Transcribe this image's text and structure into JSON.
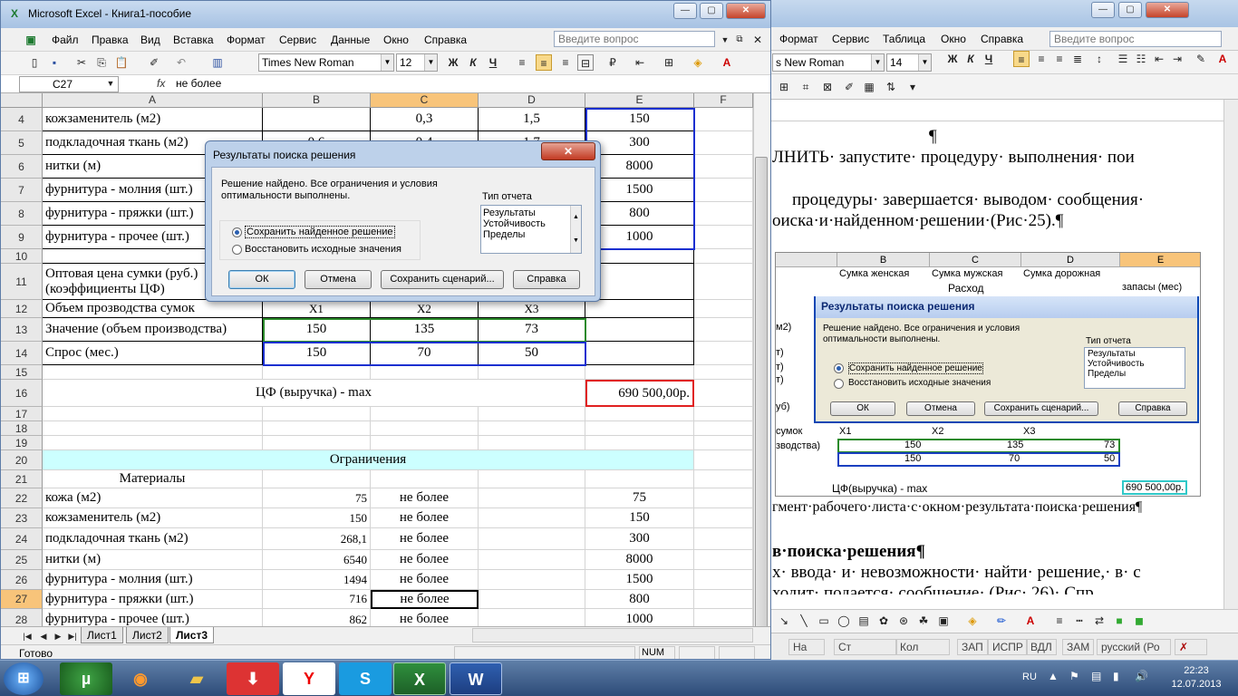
{
  "excel": {
    "title": "Microsoft Excel - Книга1-пособие",
    "menu": [
      "Файл",
      "Правка",
      "Вид",
      "Вставка",
      "Формат",
      "Сервис",
      "Данные",
      "Окно",
      "Справка"
    ],
    "ask_placeholder": "Введите вопрос",
    "font": "Times New Roman",
    "font_size": "12",
    "name_box": "C27",
    "fx": "fx",
    "formula": "не более",
    "columns": [
      "A",
      "B",
      "C",
      "D",
      "E",
      "F"
    ],
    "rows": [
      {
        "n": "4",
        "a": "кожзаменитель (м2)",
        "b": "",
        "c": "0,3",
        "d": "1,5",
        "e": "150"
      },
      {
        "n": "5",
        "a": "подкладочная ткань (м2)",
        "b": "0,6",
        "c": "0,4",
        "d": "1,7",
        "e": "300"
      },
      {
        "n": "6",
        "a": "нитки (м)",
        "b": "",
        "c": "",
        "d": "",
        "e": "8000"
      },
      {
        "n": "7",
        "a": "фурнитура - молния (шт.)",
        "b": "",
        "c": "",
        "d": "",
        "e": "1500"
      },
      {
        "n": "8",
        "a": "фурнитура - пряжки (шт.)",
        "b": "",
        "c": "",
        "d": "",
        "e": "800"
      },
      {
        "n": "9",
        "a": "фурнитура - прочее (шт.)",
        "b": "",
        "c": "",
        "d": "",
        "e": "1000"
      },
      {
        "n": "10",
        "a": "",
        "b": "",
        "c": "",
        "d": "",
        "e": ""
      },
      {
        "n": "11",
        "a": "Оптовая цена сумки (руб.)",
        "a2": "(коэффициенты ЦФ)",
        "b": "",
        "c": "",
        "d": "",
        "e": ""
      },
      {
        "n": "12",
        "a": "Объем прозводства сумок",
        "b": "X1",
        "c": "X2",
        "d": "X3",
        "e": ""
      },
      {
        "n": "13",
        "a": "Значение (объем производства)",
        "b": "150",
        "c": "135",
        "d": "73",
        "e": ""
      },
      {
        "n": "14",
        "a": "Спрос (мес.)",
        "b": "150",
        "c": "70",
        "d": "50",
        "e": ""
      },
      {
        "n": "15",
        "a": "",
        "b": "",
        "c": "",
        "d": "",
        "e": ""
      },
      {
        "n": "16",
        "a": "ЦФ (выручка) - max",
        "b": "",
        "c": "",
        "d": "",
        "e": "690 500,00р."
      },
      {
        "n": "17",
        "a": "",
        "b": "",
        "c": "",
        "d": "",
        "e": ""
      },
      {
        "n": "18",
        "a": "",
        "b": "",
        "c": "",
        "d": "",
        "e": ""
      },
      {
        "n": "19",
        "a": "",
        "b": "",
        "c": "",
        "d": "",
        "e": ""
      },
      {
        "n": "20",
        "a": "Ограничения",
        "b": "",
        "c": "",
        "d": "",
        "e": ""
      },
      {
        "n": "21",
        "a": "Материалы",
        "b": "",
        "c": "",
        "d": "",
        "e": ""
      },
      {
        "n": "22",
        "a": "кожа (м2)",
        "b": "75",
        "c": "не более",
        "d": "",
        "e": "75"
      },
      {
        "n": "23",
        "a": "кожзаменитель (м2)",
        "b": "150",
        "c": "не более",
        "d": "",
        "e": "150"
      },
      {
        "n": "24",
        "a": "подкладочная ткань (м2)",
        "b": "268,1",
        "c": "не более",
        "d": "",
        "e": "300"
      },
      {
        "n": "25",
        "a": "нитки (м)",
        "b": "6540",
        "c": "не более",
        "d": "",
        "e": "8000"
      },
      {
        "n": "26",
        "a": "фурнитура - молния (шт.)",
        "b": "1494",
        "c": "не более",
        "d": "",
        "e": "1500"
      },
      {
        "n": "27",
        "a": "фурнитура - пряжки (шт.)",
        "b": "716",
        "c": "не более",
        "d": "",
        "e": "800"
      },
      {
        "n": "28",
        "a": "фурнитура - прочее (шт.)",
        "b": "862",
        "c": "не более",
        "d": "",
        "e": "1000"
      }
    ],
    "sheets": [
      "Лист1",
      "Лист2",
      "Лист3"
    ],
    "status": "Готово",
    "num": "NUM"
  },
  "dialog": {
    "title": "Результаты поиска решения",
    "message_line1": "Решение найдено. Все ограничения и условия",
    "message_line2": "оптимальности выполнены.",
    "report_label": "Тип отчета",
    "reports": [
      "Результаты",
      "Устойчивость",
      "Пределы"
    ],
    "option_keep": "Сохранить найденное решение",
    "option_restore": "Восстановить исходные значения",
    "btn_ok": "ОК",
    "btn_cancel": "Отмена",
    "btn_save": "Сохранить сценарий...",
    "btn_help": "Справка"
  },
  "word": {
    "menu": [
      "Формат",
      "Сервис",
      "Таблица",
      "Окно",
      "Справка"
    ],
    "ask_placeholder": "Введите вопрос",
    "font": "s New Roman",
    "font_size": "14",
    "doc_lines": [
      "¶",
      "ЛНИТЬ· запустите· процедуру· выполнения· пои",
      "процедуры· завершается· выводом· сообщения·",
      "оиска·и·найденном·решении·(Рис·25).¶",
      "гмент·рабочего·листа·с·окном·результата·поиска·решения¶",
      "в·поиска·решения¶",
      "х· ввода· и· невозможности· найти· решение,· в· с",
      "ходит· подается· сообщение· (Рис· 26)· Спр"
    ],
    "fig": {
      "cols": [
        "B",
        "C",
        "D",
        "E"
      ],
      "head": [
        "Сумка женская",
        "Сумка мужская",
        "Сумка дорожная"
      ],
      "rashod": "Расход",
      "zapasy": "запасы (мес)",
      "left_labels": [
        "м2)",
        "т)",
        "т)",
        "т)",
        "уб)",
        "сумок",
        "зводства)"
      ],
      "x": [
        "X1",
        "X2",
        "X3"
      ],
      "vals1": [
        "150",
        "135",
        "73"
      ],
      "vals2": [
        "150",
        "70",
        "50"
      ],
      "cf": "ЦФ(выручка) - max",
      "cf_val": "690 500,00р."
    },
    "status": [
      "На",
      "Ст",
      "Кол",
      "ЗАП",
      "ИСПР",
      "ВДЛ",
      "ЗАМ",
      "русский (Ро"
    ]
  },
  "taskbar": {
    "lang": "RU",
    "time": "22:23",
    "date": "12.07.2013"
  }
}
